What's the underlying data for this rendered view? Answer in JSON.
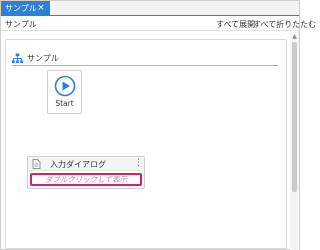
{
  "tab": {
    "title": "サンプル",
    "close_glyph": "×"
  },
  "toolbar": {
    "breadcrumb": "サンプル",
    "expand_all": "すべて展開",
    "collapse_all": "すべて折りたたむ"
  },
  "sequence": {
    "title": "サンプル",
    "icon": "sequence-icon"
  },
  "start": {
    "label": "Start",
    "icon": "play-icon"
  },
  "activity": {
    "title": "入力ダイアログ",
    "hint": "ダブルクリックして表示",
    "more_glyph": "⋮",
    "icon": "document-icon"
  },
  "colors": {
    "accent": "#2e7fd6",
    "highlight": "#d21f7d"
  }
}
